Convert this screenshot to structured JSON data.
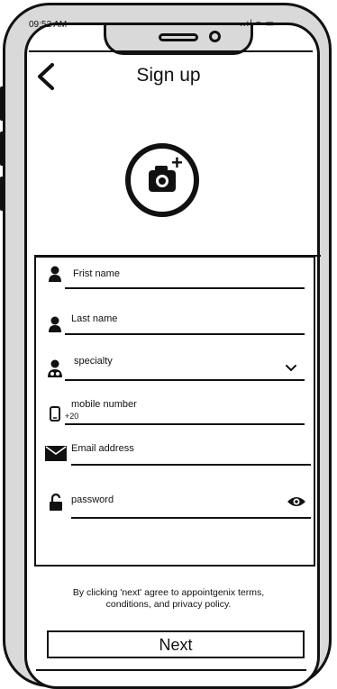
{
  "status_bar": {
    "time": "09:52 AM",
    "icons": "..ıl ≈ ▭"
  },
  "header": {
    "title": "Sign up"
  },
  "form": {
    "first_name": {
      "placeholder": "Frist name"
    },
    "last_name": {
      "placeholder": "Last name"
    },
    "specialty": {
      "placeholder": "specialty"
    },
    "mobile": {
      "placeholder": "mobile number",
      "prefix": "+20"
    },
    "email": {
      "placeholder": "Email address"
    },
    "password": {
      "placeholder": "password"
    }
  },
  "terms": {
    "text": "By clicking 'next' agree to appointgenix terms, conditions, and privacy policy."
  },
  "next_button": {
    "label": "Next"
  },
  "icons": {
    "back": "chevron-left-icon",
    "avatar": "camera-add-icon",
    "first": "person-icon",
    "last": "person-icon",
    "specialty": "doctor-icon",
    "mobile": "phone-icon",
    "email": "envelope-icon",
    "password": "lock-icon",
    "eye": "eye-icon"
  }
}
